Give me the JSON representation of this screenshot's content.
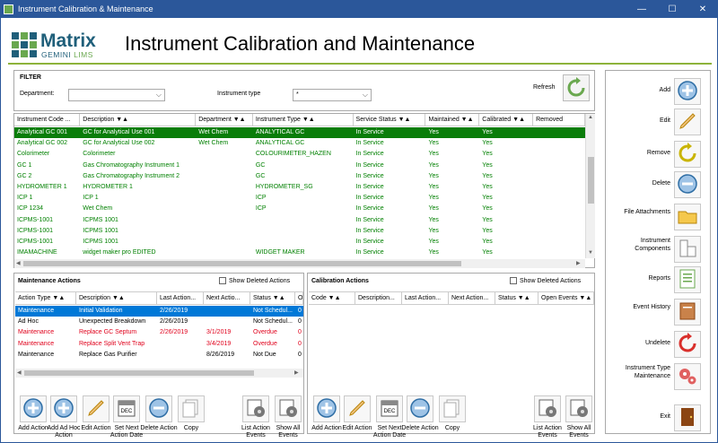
{
  "window": {
    "title": "Instrument Calibration & Maintenance",
    "minimize": "—",
    "maximize": "☐",
    "close": "✕"
  },
  "logo": {
    "word": "Matrix",
    "sub_a": "GEMINI ",
    "sub_b": "LIMS"
  },
  "page_title": "Instrument Calibration and Maintenance",
  "filter": {
    "title": "FILTER",
    "department_label": "Department:",
    "department_value": "",
    "instrument_type_label": "Instrument type",
    "instrument_type_value": "*",
    "refresh_label": "Refresh"
  },
  "instruments": {
    "columns": [
      "Instrument Code ...",
      "Description ▼▲",
      "Department ▼▲",
      "Instrument Type ▼▲",
      "Service Status ▼▲",
      "Maintained ▼▲",
      "Calibrated ▼▲",
      "Removed"
    ],
    "rows": [
      [
        "Analytical GC 001",
        "GC for Analytical Use 001",
        "Wet Chem",
        "ANALYTICAL GC",
        "In Service",
        "Yes",
        "Yes",
        ""
      ],
      [
        "Analytical GC 002",
        "GC for Analytical Use 002",
        "Wet Chem",
        "ANALYTICAL GC",
        "In Service",
        "Yes",
        "Yes",
        ""
      ],
      [
        "Colorimeter",
        "Colorimeter",
        "",
        "COLOURIMETER_HAZEN",
        "In Service",
        "Yes",
        "Yes",
        ""
      ],
      [
        "GC 1",
        "Gas Chromatography Instrument 1",
        "",
        "GC",
        "In Service",
        "Yes",
        "Yes",
        ""
      ],
      [
        "GC 2",
        "Gas Chromatography Instrument 2",
        "",
        "GC",
        "In Service",
        "Yes",
        "Yes",
        ""
      ],
      [
        "HYDROMETER 1",
        "HYDROMETER 1",
        "",
        "HYDROMETER_SG",
        "In Service",
        "Yes",
        "Yes",
        ""
      ],
      [
        "ICP 1",
        "ICP 1",
        "",
        "ICP",
        "In Service",
        "Yes",
        "Yes",
        ""
      ],
      [
        "ICP 1234",
        "Wet Chem",
        "",
        "ICP",
        "In Service",
        "Yes",
        "Yes",
        ""
      ],
      [
        "ICPMS-1001",
        "ICPMS 1001",
        "",
        "",
        "In Service",
        "Yes",
        "Yes",
        ""
      ],
      [
        "ICPMS-1001",
        "ICPMS 1001",
        "",
        "",
        "In Service",
        "Yes",
        "Yes",
        ""
      ],
      [
        "ICPMS-1001",
        "ICPMS 1001",
        "",
        "",
        "In Service",
        "Yes",
        "Yes",
        ""
      ],
      [
        "IMAMACHINE",
        "widget maker pro EDITED",
        "",
        "WIDGET MAKER",
        "In Service",
        "Yes",
        "Yes",
        ""
      ]
    ],
    "selected_row": 0
  },
  "maintenance": {
    "title": "Maintenance Actions",
    "show_deleted": "Show Deleted Actions",
    "columns": [
      "Action Type ▼▲",
      "Description ▼▲",
      "Last Action...",
      "Next Actio...",
      "Status ▼▲",
      "O"
    ],
    "rows": [
      {
        "cells": [
          "Maintenance",
          "Initial Validation",
          "2/26/2019",
          "",
          "Not Schedul...",
          "0"
        ],
        "style": "selected"
      },
      {
        "cells": [
          "Ad Hoc",
          "Unexpected Breakdown",
          "2/26/2019",
          "",
          "Not Schedul...",
          "0"
        ],
        "style": "normal"
      },
      {
        "cells": [
          "Maintenance",
          "Replace GC Septum",
          "2/26/2019",
          "3/1/2019",
          "Overdue",
          "0"
        ],
        "style": "overdue"
      },
      {
        "cells": [
          "Maintenance",
          "Replace Split Vent Trap",
          "",
          "3/4/2019",
          "Overdue",
          "0"
        ],
        "style": "overdue"
      },
      {
        "cells": [
          "Maintenance",
          "Replace Gas Purifier",
          "",
          "8/26/2019",
          "Not Due",
          "0"
        ],
        "style": "normal"
      }
    ],
    "buttons": [
      "Add Action",
      "Add Ad Hoc Action",
      "Edit Action",
      "Set Next Action Date",
      "Delete Action",
      "Copy",
      "List Action Events",
      "Show All Events"
    ]
  },
  "calibration": {
    "title": "Calibration Actions",
    "show_deleted": "Show Deleted Actions",
    "columns": [
      "Code ▼▲",
      "Description...",
      "Last Action...",
      "Next Action...",
      "Status ▼▲",
      "Open Events ▼▲"
    ],
    "buttons": [
      "Add Action",
      "Edit Action",
      "Set Next Action Date",
      "Delete Action",
      "Copy",
      "List Action Events",
      "Show All Events"
    ]
  },
  "sidebar": [
    "Add",
    "Edit",
    "Remove",
    "Delete",
    "File Attachments",
    "Instrument Components",
    "Reports",
    "Event History",
    "Undelete",
    "Instrument Type Maintenance",
    "Exit"
  ],
  "colors": {
    "accent_green": "#008000",
    "selected_green": "#0a7d0a",
    "selected_blue": "#0078d7",
    "overdue": "#e0001b",
    "title_bar": "#2b579a"
  }
}
